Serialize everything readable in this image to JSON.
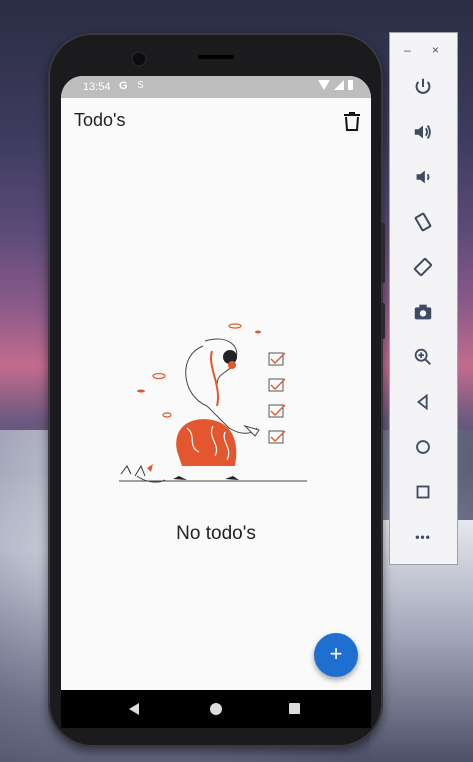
{
  "status_bar": {
    "time": "13:54",
    "g_label": "G",
    "s_label": "S"
  },
  "app_bar": {
    "title": "Todo's"
  },
  "empty_state": {
    "message": "No todo's"
  },
  "fab": {
    "label": "+"
  },
  "emulator_panel": {
    "minimize_label": "–",
    "close_label": "×",
    "more_label": "•••"
  },
  "colors": {
    "accent": "#1e6fd0",
    "illustration": "#e4572e"
  }
}
